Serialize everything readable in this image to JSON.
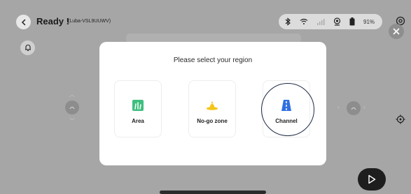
{
  "header": {
    "title": "Ready !",
    "device": "(Luba-VSL9UUWV)",
    "battery": "91%"
  },
  "modal": {
    "title": "Please select your region",
    "options": [
      {
        "label": "Area",
        "icon": "grass-icon",
        "color": "#3fbf7f"
      },
      {
        "label": "No-go zone",
        "icon": "cone-icon",
        "color": "#f5c518"
      },
      {
        "label": "Channel",
        "icon": "road-icon",
        "color": "#2f6fe0"
      }
    ],
    "selected": "Channel"
  },
  "colors": {
    "accent_ring": "#1d2b45",
    "area_green": "#3fbf7f",
    "nogo_yellow": "#f5c518",
    "channel_blue": "#2f6fe0"
  }
}
